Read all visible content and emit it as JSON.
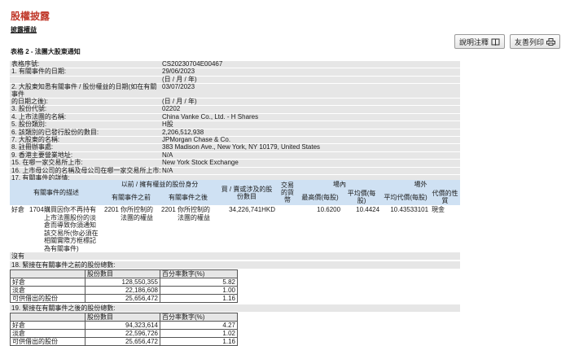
{
  "page": {
    "title": "股權披露",
    "section": "披露權益",
    "form_title": "表格 2 - 法團大股東通知"
  },
  "toolbar": {
    "help_label": "說明注釋",
    "print_label": "友善列印"
  },
  "info_rows": [
    {
      "label": "表格序號:",
      "value": "CS20230704E00467"
    },
    {
      "label": "1. 有關事件的日期:",
      "value": "29/06/2023"
    },
    {
      "label": "",
      "value": "(日 / 月 / 年)"
    },
    {
      "label": "2. 大股東知悉有關事件 / 股份權益的日期(如在有關事件",
      "value": "03/07/2023"
    },
    {
      "label": "的日期之後):",
      "value": "(日 / 月 / 年)"
    },
    {
      "label": "3. 股份代號:",
      "value": "02202"
    },
    {
      "label": "4. 上市法團的名稱:",
      "value": "China Vanke Co., Ltd. - H Shares"
    },
    {
      "label": "5. 股份類別:",
      "value": "H股"
    },
    {
      "label": "6. 該類別的已發行股份的數目:",
      "value": "2,206,512,938"
    },
    {
      "label": "7. 大股東的名稱:",
      "value": "JPMorgan Chase & Co."
    },
    {
      "label": "8. 註冊辦事處:",
      "value": "383 Madison Ave., New York, NY 10179, United States"
    },
    {
      "label": "9. 香港主要營業地址:",
      "value": "N/A"
    },
    {
      "label": "15. 在哪一家交易所上市:",
      "value": "New York Stock Exchange"
    },
    {
      "label": "16. 上市母公司的名稱及母公司在哪一家交易所上市:",
      "value": "N/A"
    },
    {
      "label": "17. 有關事件的詳情:",
      "value": ""
    }
  ],
  "event_table": {
    "headers": {
      "event_code": "有關事件的描述",
      "before": "以前 / 擁有權益的股份身分",
      "before_sub": "有關事件之前",
      "after_sub": "有關事件之後",
      "capacity": "買 / 賣或涉及的股份數目",
      "currency": "交易的貨幣",
      "onex": "場內",
      "onex_high": "最高價(每股)",
      "onex_avg": "平均價(每股)",
      "offex": "場外",
      "offex_avg": "平均代價(每股)",
      "offex_nature": "代價的性質"
    },
    "row": {
      "position": "好倉",
      "code": "1704",
      "description": "購買因你不再持有上市法團股份的淡倉而導致你須通知該交易所(你必須在相關實際方框標記為有關事件)",
      "cap_before_code": "2201",
      "cap_before": "你所控制的法團的權益",
      "cap_after_code": "2201",
      "cap_after": "你所控制的法團的權益",
      "shares": "34,226,741",
      "currency": "HKD",
      "high": "10.6200",
      "avg": "10.4424",
      "offex_avg": "10.43533101",
      "nature": "現金"
    }
  },
  "remarks": "沒有",
  "section18": {
    "title": "18. 緊接在有關事件之前的股份總數:",
    "col_shares": "股份數目",
    "col_pct": "百分率數字(%)",
    "rows": [
      {
        "label": "好倉",
        "shares": "128,550,355",
        "pct": "5.82"
      },
      {
        "label": "淡倉",
        "shares": "22,186,608",
        "pct": "1.00"
      },
      {
        "label": "可供借出的股份",
        "shares": "25,656,472",
        "pct": "1.16"
      }
    ]
  },
  "section19": {
    "title": "19. 緊接在有關事件之後的股份總數:",
    "col_shares": "股份數目",
    "col_pct": "百分率數字(%)",
    "rows": [
      {
        "label": "好倉",
        "shares": "94,323,614",
        "pct": "4.27"
      },
      {
        "label": "淡倉",
        "shares": "22,596,726",
        "pct": "1.02"
      },
      {
        "label": "可供借出的股份",
        "shares": "25,656,472",
        "pct": "1.16"
      }
    ]
  }
}
